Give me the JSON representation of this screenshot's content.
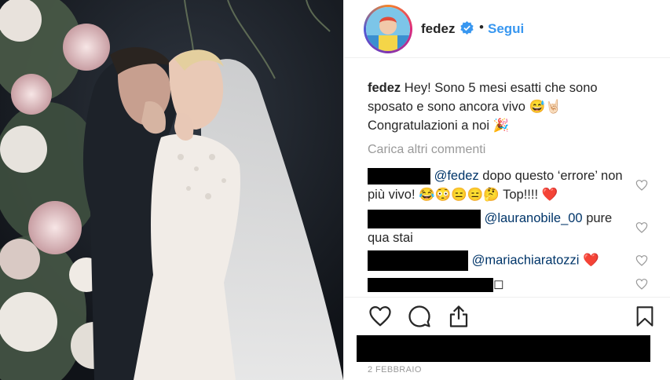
{
  "post": {
    "username": "fedez",
    "follow_label": "Segui",
    "dot": "•",
    "caption_user": "fedez",
    "caption_text": "Hey! Sono 5 mesi esatti che sono sposato e sono ancora vivo 😅🤘🏻 Congratulazioni a noi 🎉",
    "load_more": "Carica altri commenti",
    "date": "2 FEBBRAIO"
  },
  "comments": [
    {
      "mention": "@fedez",
      "text": " dopo questo ‘errore’ non più vivo! 😂😳😑😑🤔 Top!!!! ",
      "heart": "❤️"
    },
    {
      "mention": "@lauranobile_00",
      "text": " pure qua stai",
      "heart": ""
    },
    {
      "mention": "@mariachiaratozzi",
      "text": " ",
      "heart": "❤️"
    },
    {
      "mention": "",
      "text": "◻",
      "heart": ""
    }
  ],
  "icons": {
    "like": "heart-outline-icon",
    "comment": "speech-bubble-icon",
    "share": "share-upload-icon",
    "save": "bookmark-icon",
    "verified": "verified-badge-icon"
  },
  "colors": {
    "accent": "#3897f0",
    "text": "#262626",
    "muted": "#999999"
  }
}
